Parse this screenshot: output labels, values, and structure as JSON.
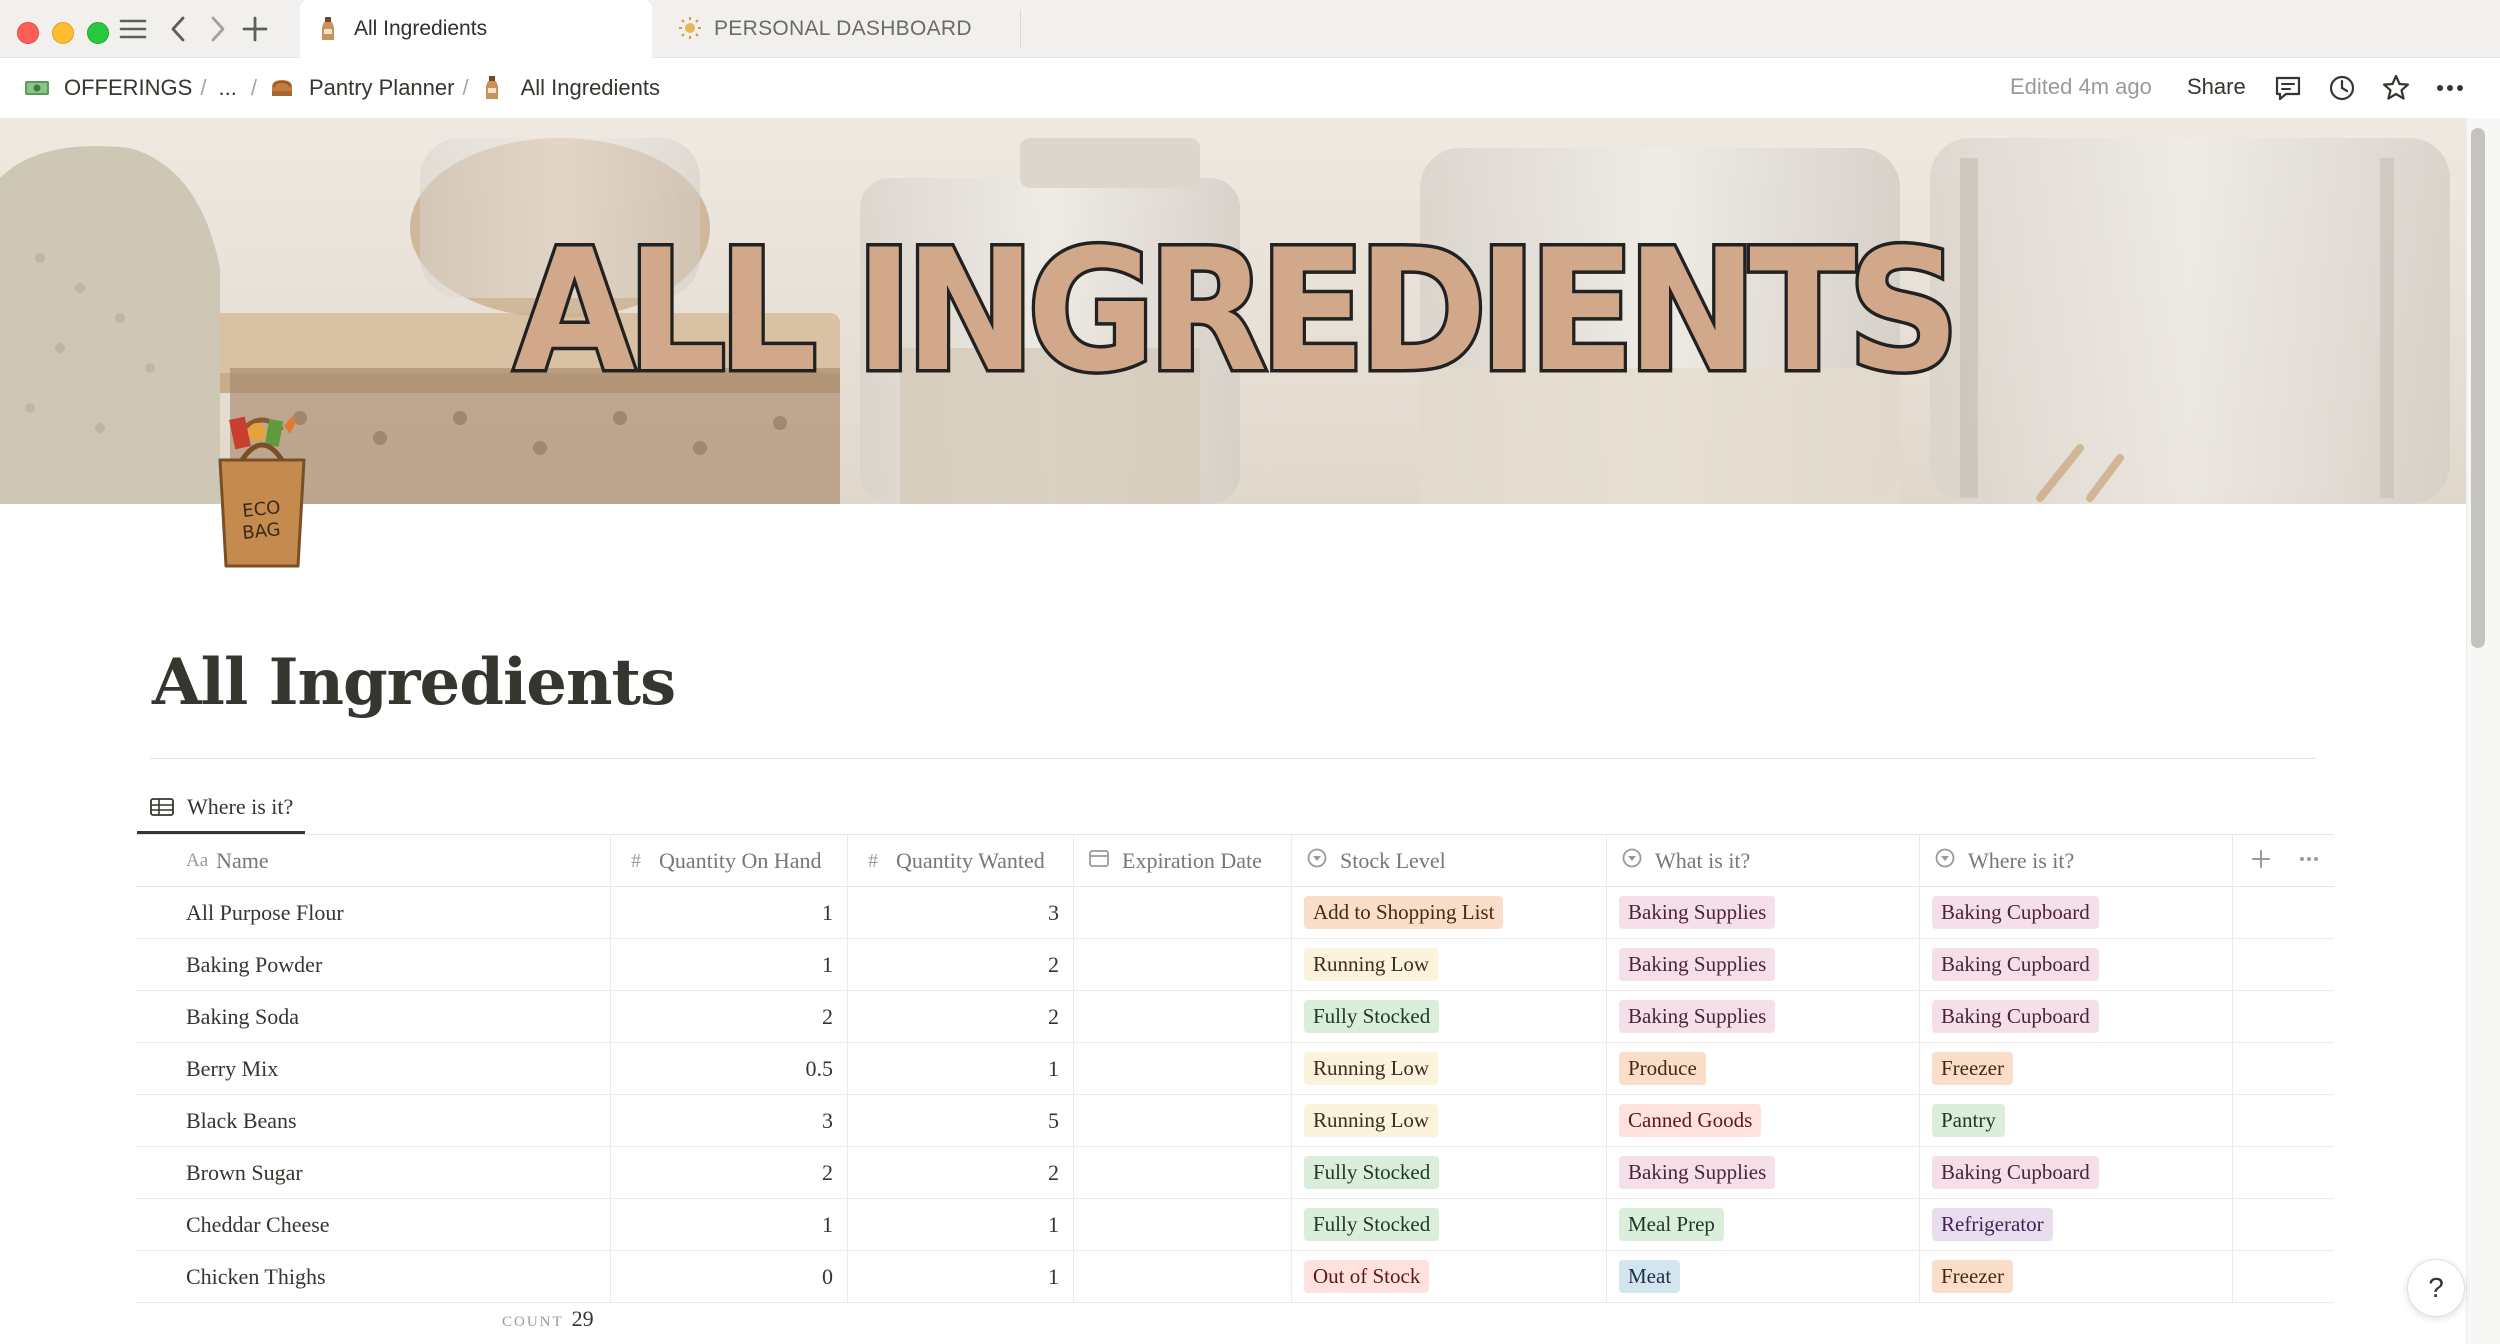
{
  "window": {
    "tabs": [
      {
        "label": "All Ingredients",
        "active": true,
        "icon": "bottle-icon"
      },
      {
        "label": "PERSONAL DASHBOARD",
        "active": false,
        "icon": "sun-icon"
      }
    ]
  },
  "breadcrumb": {
    "items": [
      {
        "label": "OFFERINGS",
        "icon": "money-icon"
      },
      {
        "label": "..."
      },
      {
        "label": "Pantry Planner",
        "icon": "bread-icon"
      },
      {
        "label": "All Ingredients",
        "icon": "bottle-icon"
      }
    ],
    "separator": "/"
  },
  "topbar": {
    "edited": "Edited 4m ago",
    "share": "Share"
  },
  "cover": {
    "title": "ALL INGREDIENTS"
  },
  "page": {
    "icon_text": "ECO BAG",
    "title": "All Ingredients",
    "view_tab": "Where is it?"
  },
  "table": {
    "columns": [
      {
        "label": "Name",
        "icon": "text-icon",
        "icon_glyph": "Aa"
      },
      {
        "label": "Quantity On Hand",
        "icon": "number-icon",
        "icon_glyph": "#"
      },
      {
        "label": "Quantity Wanted",
        "icon": "number-icon",
        "icon_glyph": "#"
      },
      {
        "label": "Expiration Date",
        "icon": "calendar-icon",
        "icon_glyph": "▦"
      },
      {
        "label": "Stock Level",
        "icon": "select-icon",
        "icon_glyph": "⊙"
      },
      {
        "label": "What is it?",
        "icon": "select-icon",
        "icon_glyph": "⊙"
      },
      {
        "label": "Where is it?",
        "icon": "select-icon",
        "icon_glyph": "⊙"
      }
    ],
    "rows": [
      {
        "name": "All Purpose Flour",
        "on_hand": "1",
        "wanted": "3",
        "expiration": "",
        "stock": "Add to Shopping List",
        "what": "Baking Supplies",
        "where": "Baking Cupboard"
      },
      {
        "name": "Baking Powder",
        "on_hand": "1",
        "wanted": "2",
        "expiration": "",
        "stock": "Running Low",
        "what": "Baking Supplies",
        "where": "Baking Cupboard"
      },
      {
        "name": "Baking Soda",
        "on_hand": "2",
        "wanted": "2",
        "expiration": "",
        "stock": "Fully Stocked",
        "what": "Baking Supplies",
        "where": "Baking Cupboard"
      },
      {
        "name": "Berry Mix",
        "on_hand": "0.5",
        "wanted": "1",
        "expiration": "",
        "stock": "Running Low",
        "what": "Produce",
        "where": "Freezer"
      },
      {
        "name": "Black Beans",
        "on_hand": "3",
        "wanted": "5",
        "expiration": "",
        "stock": "Running Low",
        "what": "Canned Goods",
        "where": "Pantry"
      },
      {
        "name": "Brown Sugar",
        "on_hand": "2",
        "wanted": "2",
        "expiration": "",
        "stock": "Fully Stocked",
        "what": "Baking Supplies",
        "where": "Baking Cupboard"
      },
      {
        "name": "Cheddar Cheese",
        "on_hand": "1",
        "wanted": "1",
        "expiration": "",
        "stock": "Fully Stocked",
        "what": "Meal Prep",
        "where": "Refrigerator"
      },
      {
        "name": "Chicken Thighs",
        "on_hand": "0",
        "wanted": "1",
        "expiration": "",
        "stock": "Out of Stock",
        "what": "Meat",
        "where": "Freezer"
      }
    ],
    "count_label": "COUNT",
    "count_value": "29"
  },
  "tag_colors": {
    "Add to Shopping List": {
      "bg": "#fadec9",
      "fg": "#49290e"
    },
    "Running Low": {
      "bg": "#fbf3db",
      "fg": "#402c1b"
    },
    "Fully Stocked": {
      "bg": "#dbeddb",
      "fg": "#1c3829"
    },
    "Out of Stock": {
      "bg": "#ffe2dd",
      "fg": "#5d1715"
    },
    "Baking Supplies": {
      "bg": "#f5e0e9",
      "fg": "#4c2337"
    },
    "Produce": {
      "bg": "#fadec9",
      "fg": "#49290e"
    },
    "Canned Goods": {
      "bg": "#ffe2dd",
      "fg": "#5d1715"
    },
    "Meal Prep": {
      "bg": "#dbeddb",
      "fg": "#1c3829"
    },
    "Meat": {
      "bg": "#d3e5ef",
      "fg": "#183347"
    },
    "Baking Cupboard": {
      "bg": "#f5e0e9",
      "fg": "#4c2337"
    },
    "Freezer": {
      "bg": "#fadec9",
      "fg": "#49290e"
    },
    "Pantry": {
      "bg": "#dbeddb",
      "fg": "#1c3829"
    },
    "Refrigerator": {
      "bg": "#e8deee",
      "fg": "#412454"
    }
  },
  "help": "?"
}
